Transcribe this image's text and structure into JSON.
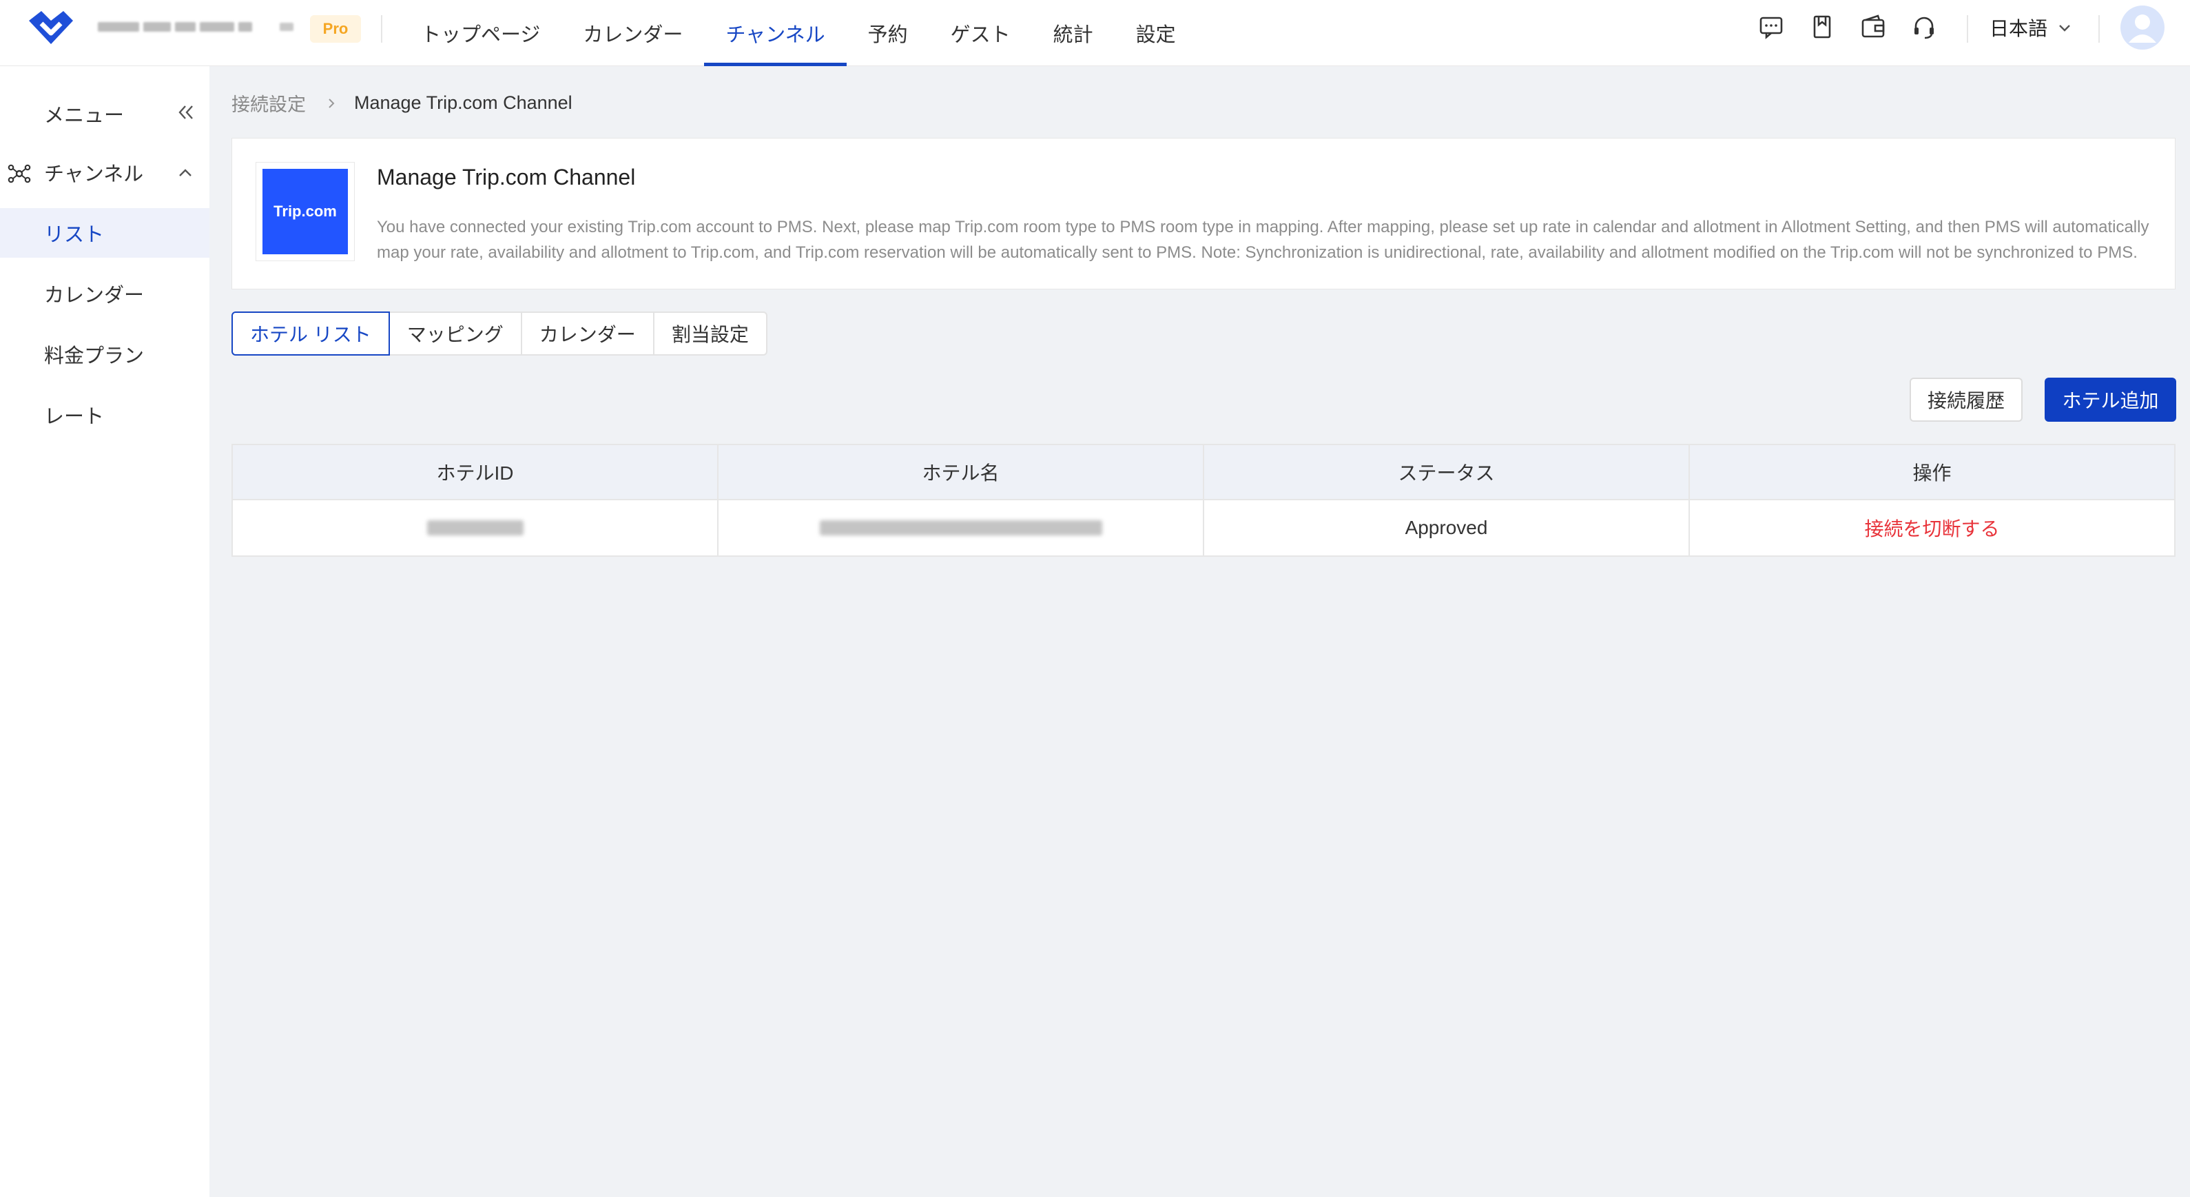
{
  "header": {
    "badge": "Pro",
    "nav": [
      {
        "label": "トップページ",
        "active": false
      },
      {
        "label": "カレンダー",
        "active": false
      },
      {
        "label": "チャンネル",
        "active": true
      },
      {
        "label": "予約",
        "active": false
      },
      {
        "label": "ゲスト",
        "active": false
      },
      {
        "label": "統計",
        "active": false
      },
      {
        "label": "設定",
        "active": false
      }
    ],
    "icons": [
      "message-icon",
      "bookmark-icon",
      "wallet-icon",
      "support-headset-icon"
    ],
    "language": "日本語",
    "accent_color": "#1747c4"
  },
  "sidebar": {
    "menu_label": "メニュー",
    "group_label": "チャンネル",
    "items": [
      {
        "label": "リスト",
        "active": true
      },
      {
        "label": "カレンダー",
        "active": false
      },
      {
        "label": "料金プラン",
        "active": false
      },
      {
        "label": "レート",
        "active": false
      }
    ]
  },
  "breadcrumb": {
    "parent": "接続設定",
    "current": "Manage Trip.com Channel"
  },
  "info_card": {
    "logo_text": "Trip.com",
    "title": "Manage Trip.com Channel",
    "description": "You have connected your existing Trip.com account to PMS. Next, please map Trip.com room type to PMS room type in mapping. After mapping, please set up rate in calendar and allotment in Allotment Setting, and then PMS will automatically map your rate, availability and allotment to Trip.com, and Trip.com reservation will be automatically sent to PMS. Note: Synchronization is unidirectional, rate, availability and allotment modified on the Trip.com will not be synchronized to PMS."
  },
  "tabs": [
    {
      "label": "ホテル リスト",
      "active": true
    },
    {
      "label": "マッピング",
      "active": false
    },
    {
      "label": "カレンダー",
      "active": false
    },
    {
      "label": "割当設定",
      "active": false
    }
  ],
  "actions": {
    "history_label": "接続履歴",
    "add_label": "ホテル追加"
  },
  "table": {
    "columns": [
      "ホテルID",
      "ホテル名",
      "ステータス",
      "操作"
    ],
    "rows": [
      {
        "status": "Approved",
        "action": "接続を切断する"
      }
    ]
  }
}
